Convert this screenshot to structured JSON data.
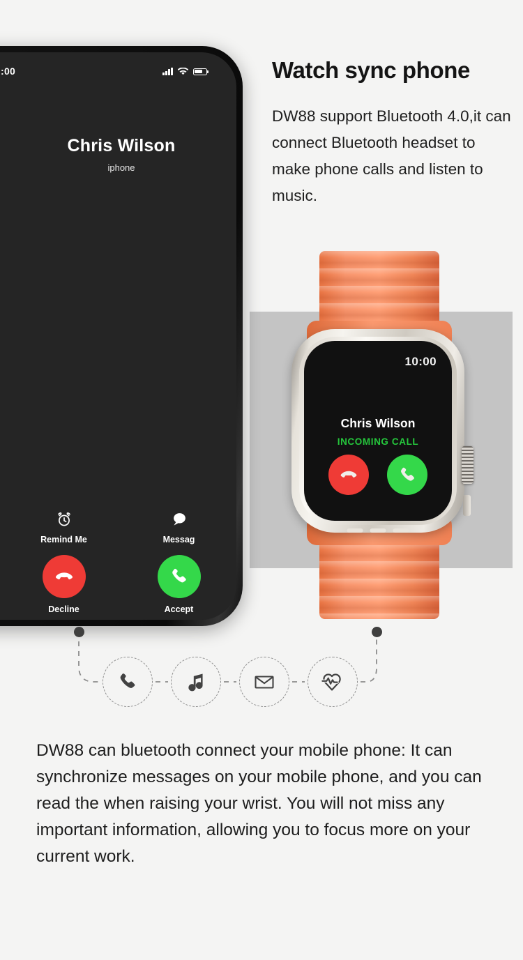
{
  "page": {
    "background_color": "#f4f4f3",
    "gray_panel_color": "#c4c4c4"
  },
  "headline": "Watch sync phone",
  "sub_copy": "DW88 support Bluetooth 4.0,it can connect Bluetooth headset to make phone calls and listen to music.",
  "bottom_copy": "DW88 can bluetooth connect your mobile phone: It can synchronize messages on your mobile phone, and you can read the when raising your wrist. You will not miss any important information, allowing you to focus more on your current work.",
  "phone": {
    "status_time": ":00",
    "icons": [
      "signal-icon",
      "wifi-icon",
      "battery-icon"
    ],
    "caller_name": "Chris Wilson",
    "caller_subtitle": "iphone",
    "actions": [
      {
        "label": "Remind Me",
        "icon": "alarm-clock-icon"
      },
      {
        "label": "Messag",
        "icon": "message-bubble-icon"
      }
    ],
    "calls": [
      {
        "label": "Decline",
        "icon": "phone-hangup-icon",
        "color": "#ef3b36"
      },
      {
        "label": "Accept",
        "icon": "phone-answer-icon",
        "color": "#34d84a"
      }
    ]
  },
  "watch": {
    "band_color": "#f5915f",
    "case_color": "#ded9d1",
    "screen_time": "10:00",
    "caller_name": "Chris Wilson",
    "call_status": "INCOMING CALL",
    "call_status_color": "#25c63c",
    "buttons": [
      {
        "name": "decline",
        "icon": "phone-hangup-icon",
        "color": "#ef3b36"
      },
      {
        "name": "accept",
        "icon": "phone-answer-icon",
        "color": "#34d84a"
      }
    ]
  },
  "features": [
    {
      "icon": "phone-call-icon",
      "label": "phone call"
    },
    {
      "icon": "music-note-icon",
      "label": "music"
    },
    {
      "icon": "envelope-icon",
      "label": "message"
    },
    {
      "icon": "heart-rate-icon",
      "label": "heart rate"
    }
  ]
}
